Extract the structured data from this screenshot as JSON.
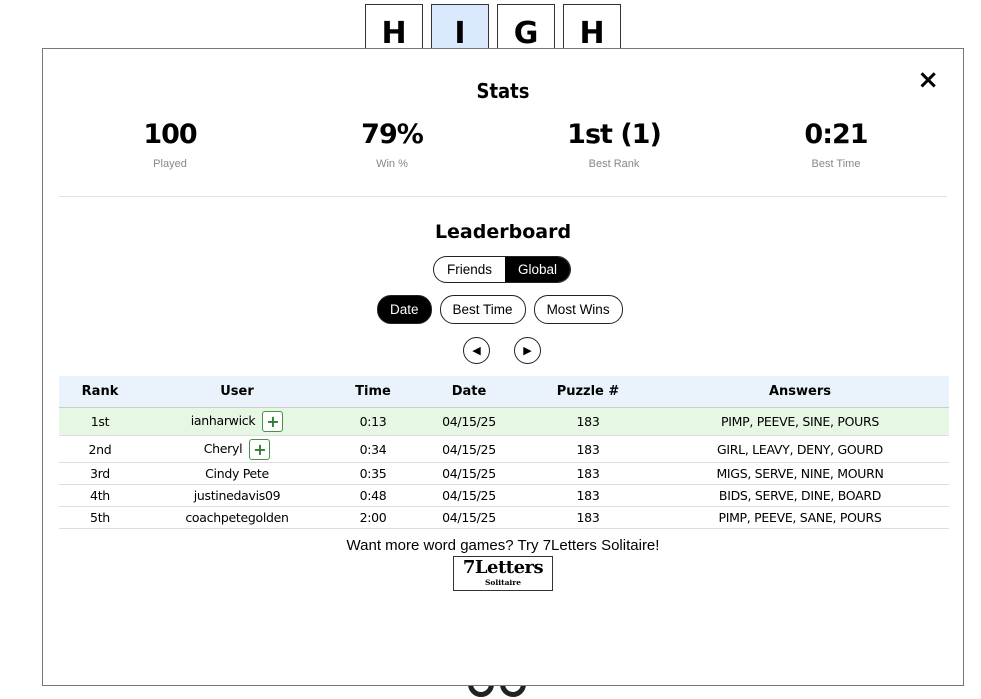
{
  "tiles": [
    "H",
    "I",
    "G",
    "H"
  ],
  "stats": {
    "title": "Stats",
    "items": [
      {
        "value": "100",
        "label": "Played"
      },
      {
        "value": "79%",
        "label": "Win %"
      },
      {
        "value": "1st (1)",
        "label": "Best Rank"
      },
      {
        "value": "0:21",
        "label": "Best Time"
      }
    ]
  },
  "close_label": "×",
  "leaderboard": {
    "title": "Leaderboard",
    "scope": {
      "friends": "Friends",
      "global": "Global",
      "selected": "Global"
    },
    "sort": {
      "date": "Date",
      "best_time": "Best Time",
      "most_wins": "Most Wins",
      "selected": "Date"
    },
    "prev_icon": "◀",
    "next_icon": "▶",
    "columns": [
      "Rank",
      "User",
      "Time",
      "Date",
      "Puzzle #",
      "Answers"
    ],
    "rows": [
      {
        "rank": "1st",
        "user": "ianharwick",
        "time": "0:13",
        "date": "04/15/25",
        "puzzle": "183",
        "answers": "PIMP, PEEVE, SINE, POURS",
        "add": "+"
      },
      {
        "rank": "2nd",
        "user": "Cheryl",
        "time": "0:34",
        "date": "04/15/25",
        "puzzle": "183",
        "answers": "GIRL, LEAVY, DENY, GOURD",
        "add": "+"
      },
      {
        "rank": "3rd",
        "user": "Cindy Pete",
        "time": "0:35",
        "date": "04/15/25",
        "puzzle": "183",
        "answers": "MIGS, SERVE, NINE, MOURN"
      },
      {
        "rank": "4th",
        "user": "justinedavis09",
        "time": "0:48",
        "date": "04/15/25",
        "puzzle": "183",
        "answers": "BIDS, SERVE, DINE, BOARD"
      },
      {
        "rank": "5th",
        "user": "coachpetegolden",
        "time": "2:00",
        "date": "04/15/25",
        "puzzle": "183",
        "answers": "PIMP, PEEVE, SANE, POURS"
      }
    ]
  },
  "promo": {
    "text": "Want more word games? Try 7Letters Solitaire!",
    "logo_main": "7Letters",
    "logo_sub": "Solitaire"
  },
  "colors": {
    "active_tile": "#dbe9ff",
    "highlight_row": "#e6f7e3",
    "header_row": "#eaf3fc",
    "add_button": "#2e7d32"
  }
}
